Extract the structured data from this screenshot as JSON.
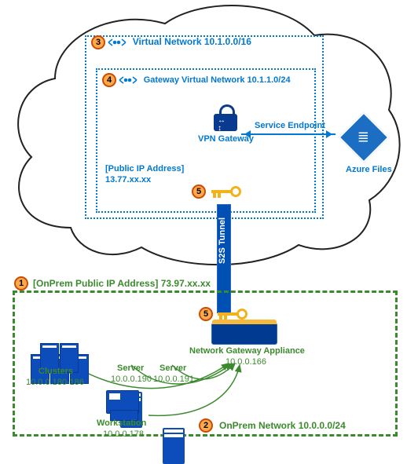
{
  "cloud": {
    "vnet": {
      "badge": "3",
      "label": "Virtual Network 10.1.0.0/16"
    },
    "gateway_subnet": {
      "badge": "4",
      "label": "Gateway Virtual Network 10.1.1.0/24"
    },
    "vpn_gateway_label": "VPN Gateway",
    "public_ip_label": "[Public IP Address]",
    "public_ip_value": "13.77.xx.xx",
    "s2s_label": "S2S Tunnel",
    "key_badge": "5",
    "service_endpoint_label": "Service Endpoint",
    "azure_files_label": "Azure Files"
  },
  "onprem": {
    "badge": "1",
    "public_ip_label": "[OnPrem Public IP Address] 73.97.xx.xx",
    "key_badge": "5",
    "network_badge": "2",
    "network_label": "OnPrem Network 10.0.0.0/24",
    "router_label": "Network Gateway Appliance",
    "router_ip": "10.0.0.166",
    "clusters_label": "Clusters",
    "clusters_ip": "10.0.0.180-186",
    "server1_label": "Server",
    "server1_ip": "10.0.0.190",
    "server2_label": "Server",
    "server2_ip": "10.0.0.191",
    "workstation_label": "Workstation",
    "workstation_ip": "10.0.0.178"
  }
}
